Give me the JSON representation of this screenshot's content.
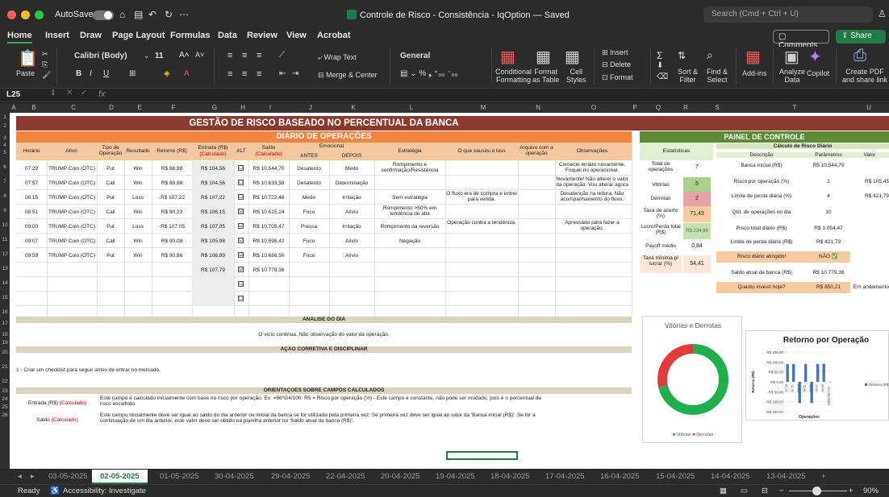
{
  "window": {
    "autosave_label": "AutoSave",
    "title": "Controle de Risco - Consistência - IqOption — Saved",
    "search_placeholder": "Search (Cmd + Ctrl + U)"
  },
  "menu": {
    "home": "Home",
    "insert": "Insert",
    "draw": "Draw",
    "page_layout": "Page Layout",
    "formulas": "Formulas",
    "data": "Data",
    "review": "Review",
    "view": "View",
    "acrobat": "Acrobat",
    "comments": "Comments",
    "share": "Share"
  },
  "ribbon": {
    "paste": "Paste",
    "font": "Calibri (Body)",
    "size": "11",
    "wrap": "Wrap Text",
    "merge": "Merge & Center",
    "number_format": "General",
    "conditional": "Conditional\nFormatting",
    "format_table": "Format\nas Table",
    "cell_styles": "Cell\nStyles",
    "insert": "Insert",
    "delete": "Delete",
    "format": "Format",
    "sort": "Sort &\nFilter",
    "find": "Find &\nSelect",
    "addins": "Add-ins",
    "analyze": "Analyze\nData",
    "copilot": "Copilot",
    "pdf": "Create PDF\nand share link"
  },
  "formula_bar": {
    "name_box": "L25",
    "fx": "fx"
  },
  "columns": [
    "A",
    "B",
    "C",
    "D",
    "E",
    "F",
    "G",
    "H",
    "I",
    "J",
    "K",
    "L",
    "M",
    "N",
    "O",
    "P",
    "Q",
    "R",
    "S",
    "T",
    "U"
  ],
  "rows": [
    "1",
    "2",
    "3",
    "4",
    "5",
    "6",
    "7",
    "8",
    "9",
    "10",
    "11",
    "12",
    "13",
    "14",
    "15",
    "16",
    "17",
    "18",
    "19",
    "20",
    "21",
    "22",
    "23",
    "24",
    "25",
    "26"
  ],
  "sheet": {
    "main_title": "GESTÃO DE RISCO BASEADO NO PERCENTUAL DA BANCA",
    "diario_title": "DIÁRIO DE OPERAÇÕES",
    "painel_title": "PAINEL DE CONTROLE",
    "headers": {
      "horario": "Horário",
      "ativo": "Ativo",
      "tipo": "Tipo de Operação",
      "resultado": "Resultado",
      "retorno": "Retorno (R$)",
      "entrada": "Entrada (R$)",
      "entrada_calc": "(Calculado)",
      "alt": "ALT",
      "saldo": "Saldo",
      "saldo_calc": "(Calculado)",
      "emocional": "Emocional",
      "antes": "ANTES",
      "depois": "DEPOIS",
      "estrategia": "Estratégia",
      "causou": "O que causou o loss",
      "arquivo": "Arquivo com a operação",
      "observacoes": "Observações"
    },
    "ops": [
      {
        "h": "07:29",
        "a": "TRUMP Coin (OTC)",
        "t": "Put",
        "r": "Win",
        "ret": "R$ 88,88",
        "e": "R$ 104,56",
        "alt": "☐",
        "s": "R$ 10.544,70",
        "antes": "Desatento",
        "depois": "Medo",
        "est": "Rompimento e confirmação/Resistência",
        "causa": "",
        "obs": "Comecei errado novamente. Foquei no operacional."
      },
      {
        "h": "07:57",
        "a": "TRUMP Coin (OTC)",
        "t": "Call",
        "r": "Win",
        "ret": "R$ 88,88",
        "e": "R$ 104,56",
        "alt": "☐",
        "s": "R$ 10.633,58",
        "antes": "Desatento",
        "depois": "Determinação",
        "est": "",
        "causa": "",
        "obs": "Novamente! Não alterei o valor da operação. Vou alterar agora"
      },
      {
        "h": "08:15",
        "a": "TRUMP Coin (OTC)",
        "t": "Put",
        "r": "Loss",
        "ret": "-R$ 107,22",
        "e": "R$ 107,22",
        "alt": "☐",
        "s": "R$ 10.722,46",
        "antes": "Medo",
        "depois": "Irritação",
        "est": "Sem estratégia",
        "causa": "O fluxo era de compra e entrei para venda.",
        "obs": "Desatenção na leitura. Não acompanhamento do fluxo."
      },
      {
        "h": "08:51",
        "a": "TRUMP Coin (OTC)",
        "t": "Call",
        "r": "Win",
        "ret": "R$ 90,23",
        "e": "R$ 106,15",
        "alt": "☑",
        "s": "R$ 10.615,24",
        "antes": "Foco",
        "depois": "Alívio",
        "est": "Rompimento >50% em tendência de alta",
        "causa": "",
        "obs": ""
      },
      {
        "h": "09:00",
        "a": "TRUMP Coin (OTC)",
        "t": "Put",
        "r": "Loss",
        "ret": "-R$ 107,05",
        "e": "R$ 107,05",
        "alt": "☑",
        "s": "R$ 10.705,47",
        "antes": "Pressa",
        "depois": "Irritação",
        "est": "Rompimento da reversão",
        "causa": "Operação contra a tendência.",
        "obs": "Apressado para fazer a operação."
      },
      {
        "h": "09:07",
        "a": "TRUMP Coin (OTC)",
        "t": "Call",
        "r": "Win",
        "ret": "R$ 90,08",
        "e": "R$ 105,98",
        "alt": "☑",
        "s": "R$ 10.598,42",
        "antes": "Foco",
        "depois": "Alívio",
        "est": "Negação",
        "causa": "",
        "obs": ""
      },
      {
        "h": "09:59",
        "a": "TRUMP Coin (OTC)",
        "t": "Put",
        "r": "Win",
        "ret": "R$ 90,86",
        "e": "R$ 106,89",
        "alt": "☑",
        "s": "R$ 10.688,50",
        "antes": "Foco",
        "depois": "Alívio",
        "est": "",
        "causa": "",
        "obs": ""
      },
      {
        "h": "",
        "a": "",
        "t": "",
        "r": "",
        "ret": "",
        "e": "R$ 107,79",
        "alt": "☑",
        "s": "R$ 10.779,36",
        "antes": "",
        "depois": "",
        "est": "",
        "causa": "",
        "obs": ""
      },
      {
        "h": "",
        "a": "",
        "t": "",
        "r": "",
        "ret": "",
        "e": "",
        "alt": "☐",
        "s": "",
        "antes": "",
        "depois": "",
        "est": "",
        "causa": "",
        "obs": ""
      },
      {
        "h": "",
        "a": "",
        "t": "",
        "r": "",
        "ret": "",
        "e": "",
        "alt": "☐",
        "s": "",
        "antes": "",
        "depois": "",
        "est": "",
        "causa": "",
        "obs": ""
      }
    ],
    "stats": {
      "title": "Estatísticas",
      "total_l": "Total de operações",
      "total_v": "7",
      "vitorias_l": "Vitórias",
      "vitorias_v": "5",
      "derrotas_l": "Derrotas",
      "derrotas_v": "2",
      "taxa_l": "Taxa de acerto (%)",
      "taxa_v": "71,43",
      "lucro_l": "Lucro/Perda total (R$)",
      "lucro_v": "R$ 234,66",
      "payoff_l": "Payoff médio",
      "payoff_v": "0,84",
      "taxa_min_l": "Taxa mínima p/ lucrar (%)",
      "taxa_min_v": "54,41"
    },
    "painel": {
      "calc_header": "Cálculo de Risco Diário",
      "desc_h": "Descrição",
      "param_h": "Parâmetros",
      "valor_h": "Valor",
      "rows": [
        {
          "d": "Banca Inicial (R$)",
          "p": "R$ 10.544,70",
          "v": ""
        },
        {
          "d": "Risco por operação (%)",
          "p": "1",
          "v": "R$ 105,45"
        },
        {
          "d": "Limite de perda diária (%)",
          "p": "4",
          "v": "R$ 421,79"
        },
        {
          "d": "Qtd. de operações no dia",
          "p": "10",
          "v": ""
        },
        {
          "d": "Risco total diário (R$)",
          "p": "R$ 1.054,47",
          "v": ""
        },
        {
          "d": "Limite de perda diária (R$)",
          "p": "R$ 421,79",
          "v": ""
        },
        {
          "d": "Risco diário atingido!",
          "p": "NÃO ✅",
          "v": ""
        },
        {
          "d": "Saldo atual da banca (R$)",
          "p": "R$ 10.779,36",
          "v": ""
        },
        {
          "d": "Quanto investi hoje?",
          "p": "R$ 850,21",
          "v": "Em andamento ✅"
        }
      ]
    },
    "analise_title": "ANÁLISE DO DIA",
    "analise_text": "O vício continua.  Não observação do valor da operação.",
    "acao_title": "AÇÃO CORRETIVA E DISCIPLINAR",
    "acao_text": "1 - Criar um checklist para seguir antes de entrar no mercado.",
    "orient_title": "ORIENTAÇÕES SOBRE CAMPOS CALCULADOS",
    "orient_entrada_l": "Entrada (R$)",
    "orient_saldo_l": "Saldo",
    "calc_tag": "(Calculado)",
    "orient_entrada_t": "Este campo é calculado inicialmente com base no risco por operação. Ex: =56*G4/100.  R5 = Risco por operação (%) - Este campo é constante, não pode ser mudado, pois é o percentual de risco escolhido.",
    "orient_saldo_t": "Este campo inicialmente deve ser igual ao saldo do dia anterior ou inicial da banca se for utilizada pela primeira vez. Se primeira vez deve ser igual ao valor da 'Banca inicial (R$)'. Se for a continuação de um dia anterior, este valor deve ser obtido na planilha anterior no 'Saldo atual da banca (R$)'."
  },
  "chart_data": [
    {
      "type": "pie",
      "title": "Vitórias e Derrotas",
      "categories": [
        "Vitórias",
        "Derrotas"
      ],
      "values": [
        5,
        2
      ],
      "colors": [
        "#20b04b",
        "#e03c3c"
      ]
    },
    {
      "type": "bar",
      "title": "Retorno por Operação",
      "xlabel": "Operações",
      "ylabel": "Retorno (R$)",
      "categories": [
        "07:29",
        "07:57",
        "08:15",
        "08:51",
        "09:00",
        "09:07",
        "09:59",
        "ANÁLISE DO..."
      ],
      "series": [
        {
          "name": "Retorno (R$)",
          "values": [
            88.88,
            88.88,
            -107.22,
            90.23,
            -107.05,
            90.08,
            90.86,
            0
          ]
        }
      ],
      "yticks": [
        "R$ 150,00",
        "R$ 100,00",
        "R$ 50,00",
        "R$ 0,00",
        "-R$ 50,00",
        "-R$ 100,00",
        "-R$ 150,00"
      ],
      "ylim": [
        -150,
        150
      ],
      "legend": "right"
    }
  ],
  "tabs": [
    "03-05-2025",
    "02-05-2025",
    "01-05-2025",
    "30-04-2025",
    "29-04-2025",
    "22-04-2025",
    "20-04-2025",
    "19-04-2025",
    "18-04-2025",
    "17-04-2025",
    "16-04-2025",
    "15-04-2025",
    "14-04-2025",
    "13-04-2025"
  ],
  "status": {
    "ready": "Ready",
    "accessibility": "Accessibility: Investigate",
    "zoom": "90%"
  }
}
